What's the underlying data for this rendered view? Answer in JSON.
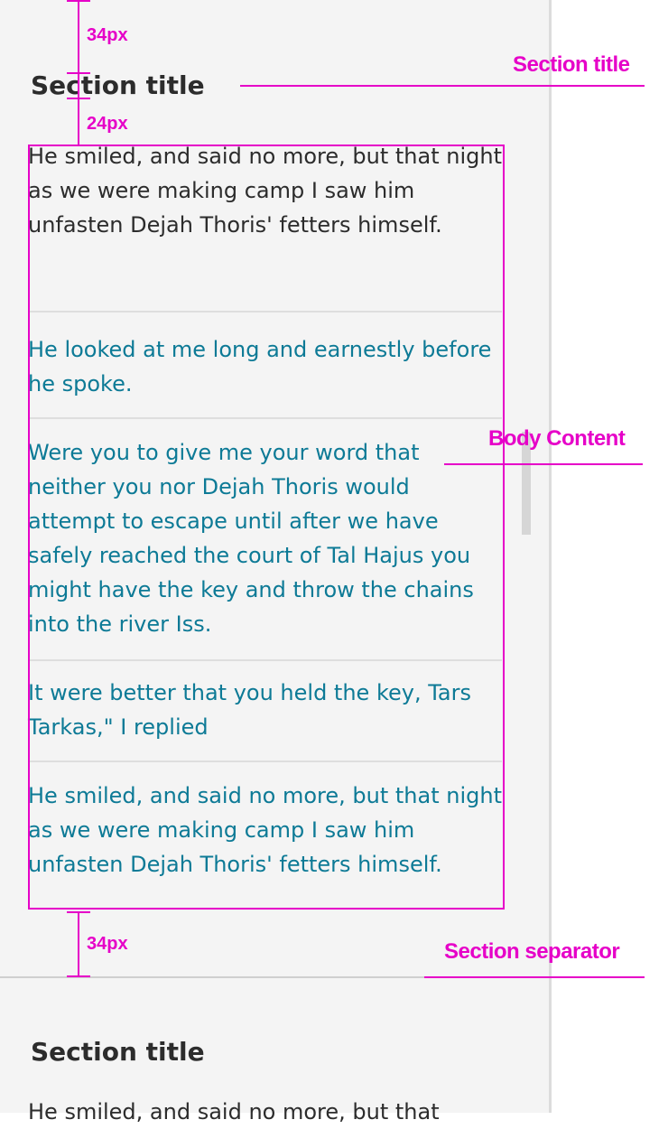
{
  "section1": {
    "title": "Section title"
  },
  "body": {
    "paragraphs": [
      "He smiled, and said no more, but that night as we were making camp I saw him unfasten Dejah Thoris' fetters himself.",
      "He looked at me long and earnestly before he spoke.",
      "Were you to give me your word that neither you nor Dejah Thoris would attempt to escape until after we have safely reached the court of Tal Hajus you might have the key and throw the chains into the river Iss.",
      "It were better that you held the key, Tars Tarkas,\" I replied",
      "He smiled, and said no more, but that night as we were making camp I saw him unfasten Dejah Thoris' fetters himself."
    ]
  },
  "section2": {
    "title": "Section title",
    "partial_text": "He smiled, and said no more, but that"
  },
  "annotations": {
    "top_gap": "34px",
    "title_gap": "24px",
    "bottom_gap": "34px",
    "section_title_label": "Section title",
    "body_content_label": "Body Content",
    "section_separator_label": "Section separator"
  },
  "colors": {
    "annotation": "#e600c8",
    "text_dark": "#2c2c2c",
    "text_teal": "#0d7a96",
    "panel_bg": "#f4f4f4"
  }
}
